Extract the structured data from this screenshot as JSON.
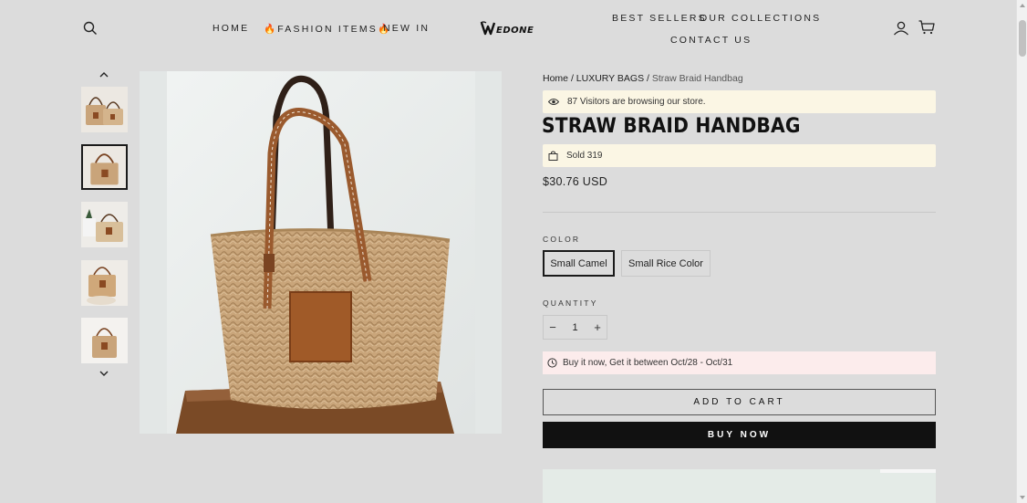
{
  "header": {
    "nav_left": [
      "HOME",
      "🔥FASHION ITEMS🔥",
      "NEW IN"
    ],
    "logo_text": "WEDONE",
    "nav_right": [
      "BEST SELLERS",
      "OUR COLLECTIONS",
      "CONTACT US"
    ]
  },
  "breadcrumb": {
    "home": "Home",
    "sep": "/",
    "category": "LUXURY BAGS",
    "current": "Straw Braid Handbag"
  },
  "product": {
    "visitors_text": "87 Visitors are browsing our store.",
    "title": "STRAW BRAID HANDBAG",
    "sold_text": "Sold 319",
    "price": "$30.76 USD",
    "color_label": "COLOR",
    "colors": [
      "Small Camel",
      "Small Rice Color"
    ],
    "selected_color": "Small Camel",
    "quantity_label": "QUANTITY",
    "quantity": "1",
    "qty_minus": "−",
    "qty_plus": "+",
    "delivery_text": "Buy it now, Get it between Oct/28 - Oct/31",
    "add_to_cart": "ADD TO CART",
    "buy_now": "BUY NOW"
  },
  "colors": {
    "info_bg": "#fbf6e4",
    "delivery_bg": "#fcecec",
    "button_dark": "#111111",
    "bag_straw": "#c9a47a",
    "bag_leather": "#8a4a22"
  },
  "icons": [
    "search-icon",
    "user-icon",
    "cart-icon",
    "eye-icon",
    "bag-icon",
    "clock-icon",
    "chevron-up-icon",
    "chevron-down-icon"
  ]
}
